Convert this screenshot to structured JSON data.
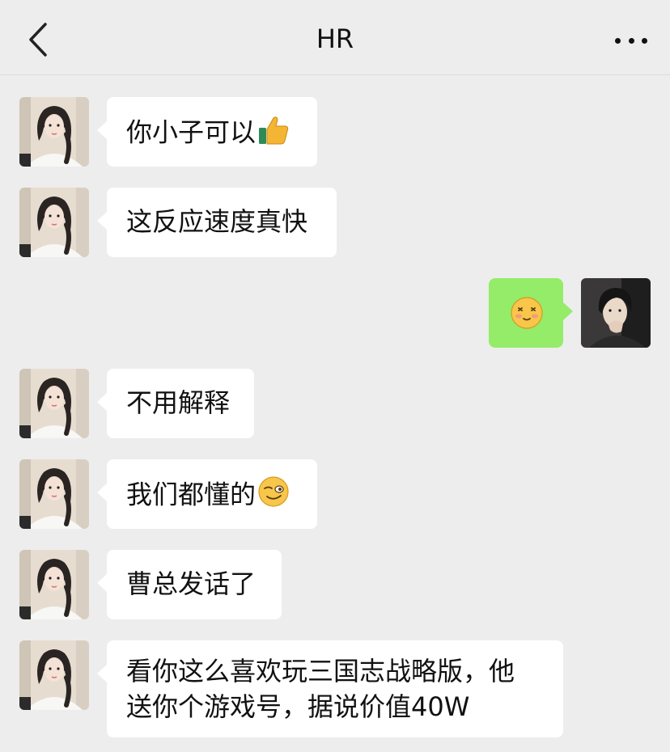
{
  "header": {
    "title": "HR",
    "back_icon": "chevron-left-icon",
    "more_icon": "more-dots-icon"
  },
  "messages": [
    {
      "side": "left",
      "text": "你小子可以",
      "emoji": "thumbs-up-icon"
    },
    {
      "side": "left",
      "text": "这反应速度真快"
    },
    {
      "side": "right",
      "emoji": "shy-smile-emoji-icon"
    },
    {
      "side": "left",
      "text": "不用解释"
    },
    {
      "side": "left",
      "text": "我们都懂的",
      "emoji": "smirk-emoji-icon"
    },
    {
      "side": "left",
      "text": "曹总发话了"
    },
    {
      "side": "left",
      "line1": "看你这么喜欢玩三国志战略版，他",
      "line2": "送你个游戏号，据说价值40W"
    }
  ],
  "colors": {
    "background": "#ededed",
    "bubble_left": "#ffffff",
    "bubble_right": "#95ec69"
  }
}
